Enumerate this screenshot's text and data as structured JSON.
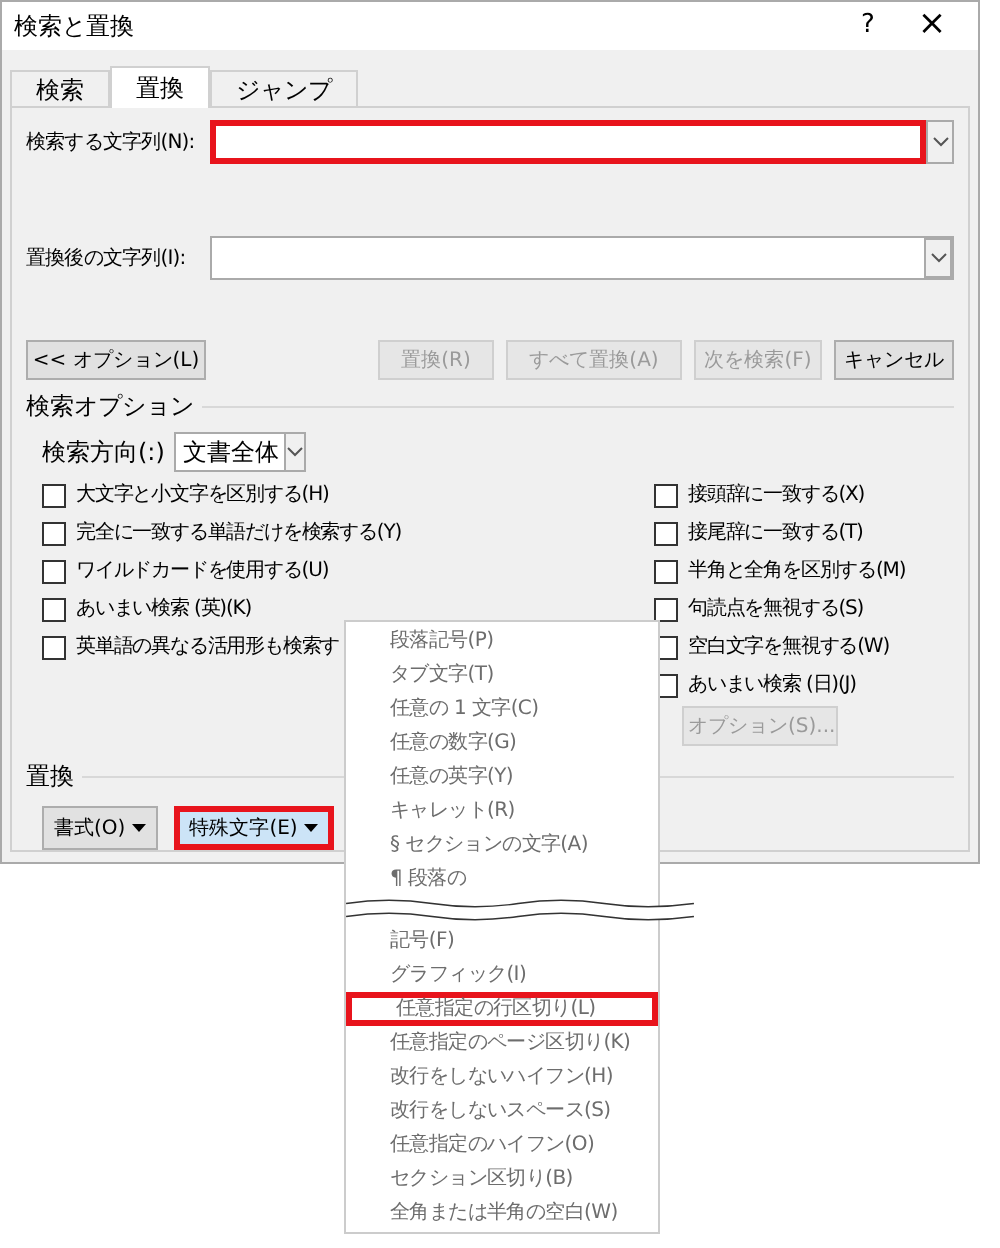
{
  "window": {
    "title": "検索と置換",
    "help": "?",
    "close": "×"
  },
  "tabs": [
    {
      "label": "検索",
      "selected": false
    },
    {
      "label": "置換",
      "selected": true
    },
    {
      "label": "ジャンプ",
      "selected": false
    }
  ],
  "find": {
    "label": "検索する文字列(N):",
    "highlighted": true
  },
  "replace": {
    "label": "置換後の文字列(I):",
    "highlighted": false
  },
  "buttons": [
    {
      "label": "<< オプション(L)",
      "disabled": false
    },
    {
      "label": "置換(R)",
      "disabled": true
    },
    {
      "label": "すべて置換(A)",
      "disabled": true
    },
    {
      "label": "次を検索(F)",
      "disabled": true
    },
    {
      "label": "キャンセル",
      "disabled": false
    }
  ],
  "options_title": "検索オプション",
  "direction": {
    "label": "検索方向(:)",
    "value": "文書全体"
  },
  "left_options": [
    {
      "label": "大文字と小文字を区別する(H)",
      "checked": false
    },
    {
      "label": "完全に一致する単語だけを検索する(Y)",
      "checked": false
    },
    {
      "label": "ワイルドカードを使用する(U)",
      "checked": false
    },
    {
      "label": "あいまい検索 (英)(K)",
      "checked": false
    },
    {
      "label": "英単語の異なる活用形も検索す",
      "checked": false
    }
  ],
  "right_options": [
    {
      "label": "接頭辞に一致する(X)",
      "checked": false
    },
    {
      "label": "接尾辞に一致する(T)",
      "checked": false
    },
    {
      "label": "半角と全角を区別する(M)",
      "checked": false
    },
    {
      "label": "句読点を無視する(S)",
      "checked": false
    },
    {
      "label": "空白文字を無視する(W)",
      "checked": false
    },
    {
      "label": "あいまい検索 (日)(J)",
      "checked": false
    }
  ],
  "fuzzy_options_button": {
    "label": "オプション(S)...",
    "disabled": true
  },
  "replace_section": {
    "title": "置換",
    "format_button": {
      "label": "書式(O)",
      "highlighted": false
    },
    "special_button": {
      "label": "特殊文字(E)",
      "highlighted": true
    }
  },
  "menu": {
    "items": [
      {
        "kind": "item",
        "label": "段落記号(P)",
        "highlighted": false
      },
      {
        "kind": "item",
        "label": "タブ文字(T)",
        "highlighted": false
      },
      {
        "kind": "item",
        "label": "任意の 1 文字(C)",
        "highlighted": false
      },
      {
        "kind": "item",
        "label": "任意の数字(G)",
        "highlighted": false
      },
      {
        "kind": "item",
        "label": "任意の英字(Y)",
        "highlighted": false
      },
      {
        "kind": "item",
        "label": "キャレット(R)",
        "highlighted": false
      },
      {
        "kind": "item",
        "label": "§ セクションの文字(A)",
        "highlighted": false
      },
      {
        "kind": "item",
        "label": "¶ 段落の",
        "highlighted": false
      },
      {
        "kind": "break"
      },
      {
        "kind": "item",
        "label": "記号(F)",
        "highlighted": false
      },
      {
        "kind": "item",
        "label": "グラフィック(I)",
        "highlighted": false
      },
      {
        "kind": "item",
        "label": "任意指定の行区切り(L)",
        "highlighted": true
      },
      {
        "kind": "item",
        "label": "任意指定のページ区切り(K)",
        "highlighted": false
      },
      {
        "kind": "item",
        "label": "改行をしないハイフン(H)",
        "highlighted": false
      },
      {
        "kind": "item",
        "label": "改行をしないスペース(S)",
        "highlighted": false
      },
      {
        "kind": "item",
        "label": "任意指定のハイフン(O)",
        "highlighted": false
      },
      {
        "kind": "item",
        "label": "セクション区切り(B)",
        "highlighted": false
      },
      {
        "kind": "item",
        "label": "全角または半角の空白(W)",
        "highlighted": false
      }
    ]
  }
}
